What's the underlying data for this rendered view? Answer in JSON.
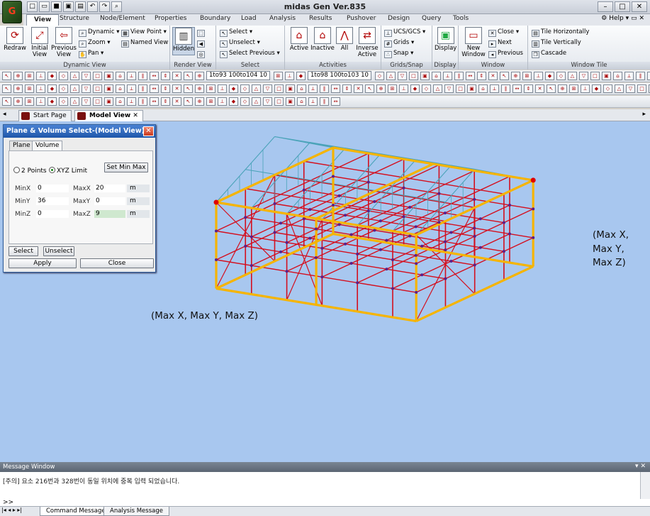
{
  "titlebar": {
    "title": "midas Gen Ver.835",
    "logo_text": "G"
  },
  "menubar": {
    "items": [
      "View",
      "Structure",
      "Node/Element",
      "Properties",
      "Boundary",
      "Load",
      "Analysis",
      "Results",
      "Pushover",
      "Design",
      "Query",
      "Tools"
    ],
    "active": "View",
    "help": "Help"
  },
  "ribbon": {
    "dynamic_view": {
      "label": "Dynamic View",
      "redraw": "Redraw",
      "initial_view": "Initial\nView",
      "previous_view": "Previous\nView",
      "dynamic": "Dynamic",
      "zoom": "Zoom",
      "pan": "Pan",
      "view_point": "View Point",
      "named_view": "Named View"
    },
    "render_view": {
      "label": "Render View",
      "hidden": "Hidden"
    },
    "select": {
      "label": "Select",
      "select": "Select",
      "unselect": "Unselect",
      "select_previous": "Select Previous"
    },
    "activities": {
      "label": "Activities",
      "active": "Active",
      "inactive": "Inactive",
      "all": "All",
      "inverse_active": "Inverse\nActive"
    },
    "grids_snap": {
      "label": "Grids/Snap",
      "ucs": "UCS/GCS",
      "grids": "Grids",
      "snap": "Snap"
    },
    "display": {
      "label": "Display",
      "display": "Display"
    },
    "window": {
      "label": "Window",
      "new_window": "New\nWindow",
      "close": "Close",
      "next": "Next",
      "previous": "Previous"
    },
    "window_tile": {
      "label": "Window Tile",
      "tile_h": "Tile Horizontally",
      "tile_v": "Tile Vertically",
      "cascade": "Cascade"
    }
  },
  "toolbar": {
    "select_1": "1to93 100to104 10",
    "select_2": "1to98 100to103 10"
  },
  "doctabs": {
    "start_page": "Start Page",
    "model_view": "Model View"
  },
  "dialog": {
    "title": "Plane & Volume Select-(Model View)",
    "tab_plane": "Plane",
    "tab_volume": "Volume",
    "radio_2points": "2 Points",
    "radio_xyz": "XYZ Limit",
    "set_min_max": "Set Min Max",
    "fields": {
      "minx_label": "MinX",
      "minx": "0",
      "maxx_label": "MaxX",
      "maxx": "20",
      "miny_label": "MinY",
      "miny": "36",
      "maxy_label": "MaxY",
      "maxy": "0",
      "minz_label": "MinZ",
      "minz": "0",
      "maxz_label": "MaxZ",
      "maxz": "9",
      "unit": "m"
    },
    "select_btn": "Select",
    "unselect_btn": "Unselect",
    "apply_btn": "Apply",
    "close_btn": "Close"
  },
  "annotations": {
    "left": "(Max X, Max Y, Max Z)",
    "right_line1": "(Max X,",
    "right_line2": "Max Y,",
    "right_line3": "Max Z)"
  },
  "message_window": {
    "title": "Message Window",
    "text": "[주의] 요소 216번과 328번이 동일 위치에 중복 입력 되었습니다.",
    "prompt": ">>",
    "tab_command": "Command Message",
    "tab_analysis": "Analysis Message"
  },
  "colors": {
    "selection_box": "#f5b400",
    "frame": "#d40f1e",
    "roof": "#4aa3b8",
    "node": "#5a1f8a",
    "viewport_bg": "#a8c7ef"
  }
}
